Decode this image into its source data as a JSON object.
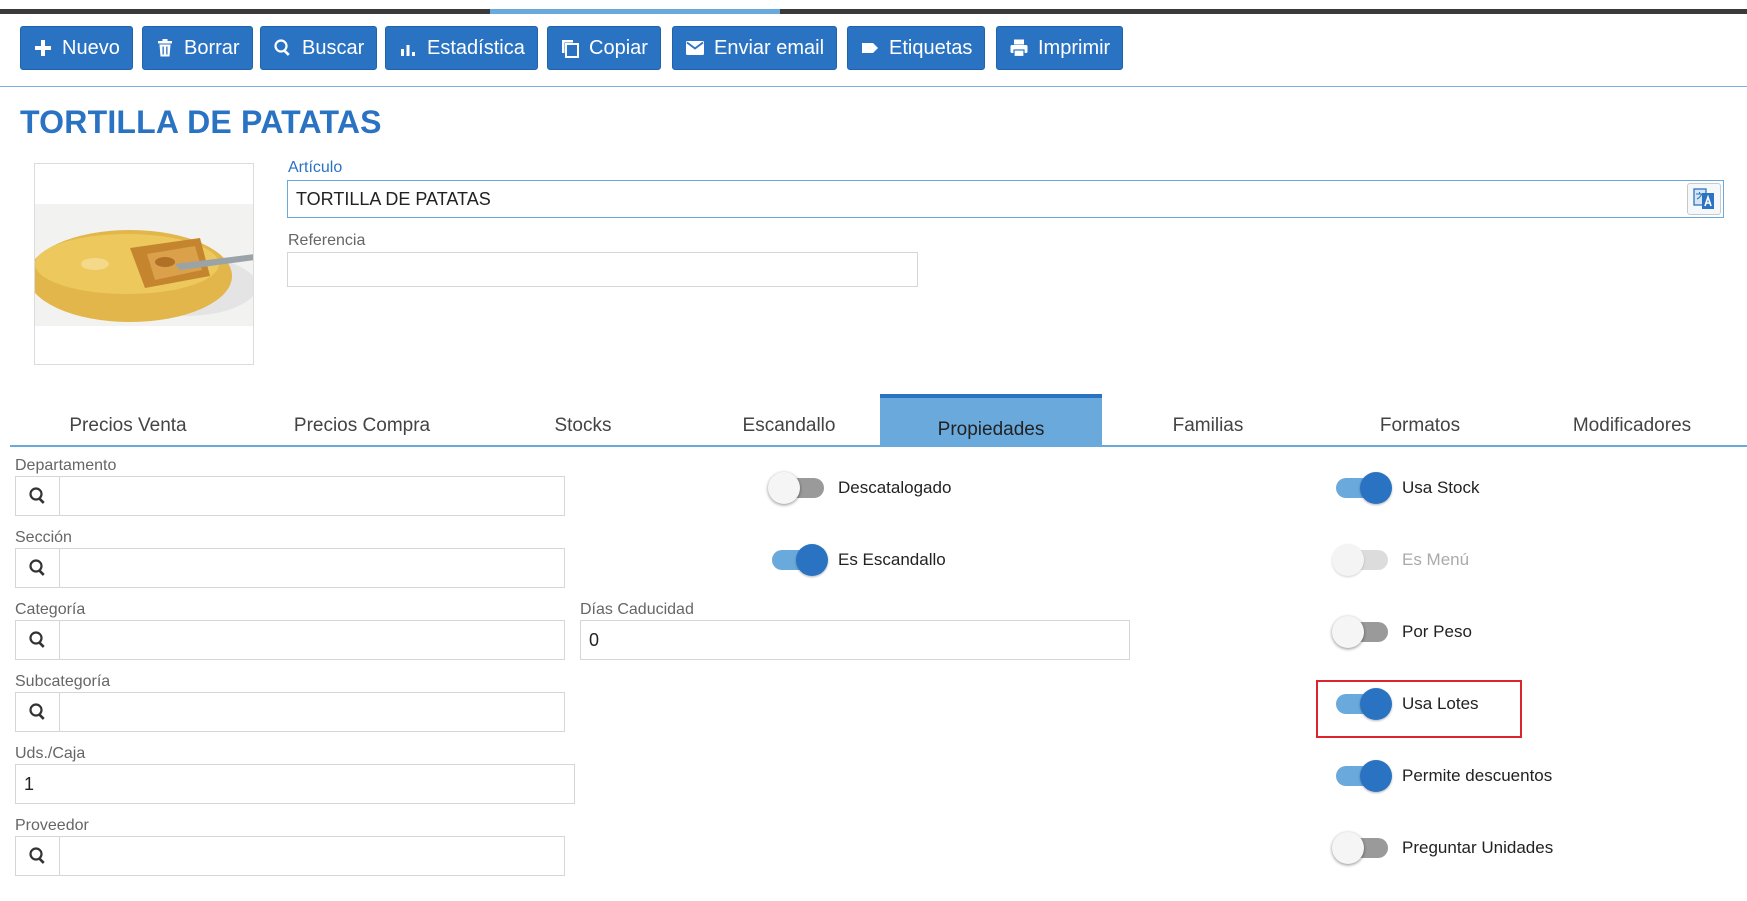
{
  "toolbar": {
    "buttons": [
      {
        "label": "Nuevo",
        "icon": "plus-icon"
      },
      {
        "label": "Borrar",
        "icon": "trash-icon"
      },
      {
        "label": "Buscar",
        "icon": "search-icon"
      },
      {
        "label": "Estadística",
        "icon": "bar-chart-icon"
      },
      {
        "label": "Copiar",
        "icon": "copy-icon"
      },
      {
        "label": "Enviar email",
        "icon": "email-icon"
      },
      {
        "label": "Etiquetas",
        "icon": "tag-icon"
      },
      {
        "label": "Imprimir",
        "icon": "print-icon"
      }
    ]
  },
  "header": {
    "title": "TORTILLA DE PATATAS"
  },
  "article": {
    "label": "Artículo",
    "value": "TORTILLA DE PATATAS",
    "reference_label": "Referencia",
    "reference_value": ""
  },
  "tabs": [
    {
      "label": "Precios Venta",
      "active": false
    },
    {
      "label": "Precios Compra",
      "active": false
    },
    {
      "label": "Stocks",
      "active": false
    },
    {
      "label": "Escandallo",
      "active": false
    },
    {
      "label": "Propiedades",
      "active": true
    },
    {
      "label": "Familias",
      "active": false
    },
    {
      "label": "Formatos",
      "active": false
    },
    {
      "label": "Modificadores",
      "active": false
    }
  ],
  "properties": {
    "departamento": {
      "label": "Departamento",
      "value": ""
    },
    "seccion": {
      "label": "Sección",
      "value": ""
    },
    "categoria": {
      "label": "Categoría",
      "value": ""
    },
    "subcategoria": {
      "label": "Subcategoría",
      "value": ""
    },
    "uds_caja": {
      "label": "Uds./Caja",
      "value": "1"
    },
    "proveedor": {
      "label": "Proveedor",
      "value": ""
    },
    "dias_caducidad": {
      "label": "Días Caducidad",
      "value": "0"
    }
  },
  "toggles": {
    "descatalogado": {
      "label": "Descatalogado",
      "on": false
    },
    "es_escandallo": {
      "label": "Es Escandallo",
      "on": true
    },
    "usa_stock": {
      "label": "Usa Stock",
      "on": true
    },
    "es_menu": {
      "label": "Es Menú",
      "on": false,
      "disabled": true
    },
    "por_peso": {
      "label": "Por Peso",
      "on": false
    },
    "usa_lotes": {
      "label": "Usa Lotes",
      "on": true
    },
    "permite_descuentos": {
      "label": "Permite descuentos",
      "on": true
    },
    "preguntar_unidades": {
      "label": "Preguntar Unidades",
      "on": false
    }
  },
  "colors": {
    "primary": "#2a73c3",
    "active_tab": "#6aa9dc",
    "highlight": "#d9252b"
  }
}
